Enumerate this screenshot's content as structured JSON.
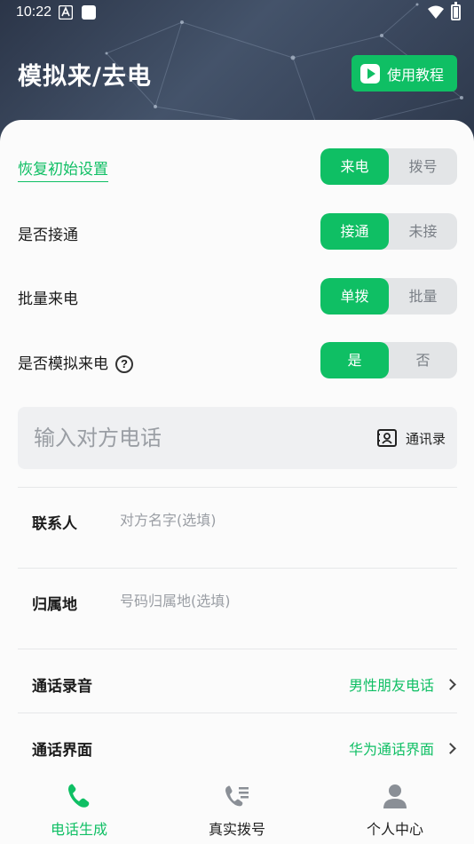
{
  "status_bar": {
    "time": "10:22"
  },
  "header": {
    "title": "模拟来/去电",
    "tutorial_label": "使用教程"
  },
  "settings": {
    "restore_label": "恢复初始设置",
    "call_direction": {
      "options": [
        "来电",
        "拨号"
      ],
      "selected": "来电"
    },
    "connected": {
      "label": "是否接通",
      "options": [
        "接通",
        "未接"
      ],
      "selected": "接通"
    },
    "batch": {
      "label": "批量来电",
      "options": [
        "单拨",
        "批量"
      ],
      "selected": "单拨"
    },
    "simulate": {
      "label": "是否模拟来电",
      "help": "?",
      "options": [
        "是",
        "否"
      ],
      "selected": "是"
    }
  },
  "phone": {
    "placeholder": "输入对方电话",
    "value": "",
    "contacts_label": "通讯录"
  },
  "contact": {
    "label": "联系人",
    "placeholder": "对方名字(选填)",
    "value": ""
  },
  "location": {
    "label": "归属地",
    "placeholder": "号码归属地(选填)",
    "value": ""
  },
  "recording": {
    "label": "通话录音",
    "value": "男性朋友电话"
  },
  "interface": {
    "label": "通话界面",
    "value": "华为通话界面"
  },
  "nav": [
    {
      "label": "电话生成",
      "icon": "phone-icon",
      "active": true
    },
    {
      "label": "真实拨号",
      "icon": "dial-list-icon",
      "active": false
    },
    {
      "label": "个人中心",
      "icon": "person-icon",
      "active": false
    }
  ],
  "colors": {
    "accent": "#0fbf64",
    "header_bg": "#3a475d",
    "segment_off": "#e3e5e7"
  }
}
